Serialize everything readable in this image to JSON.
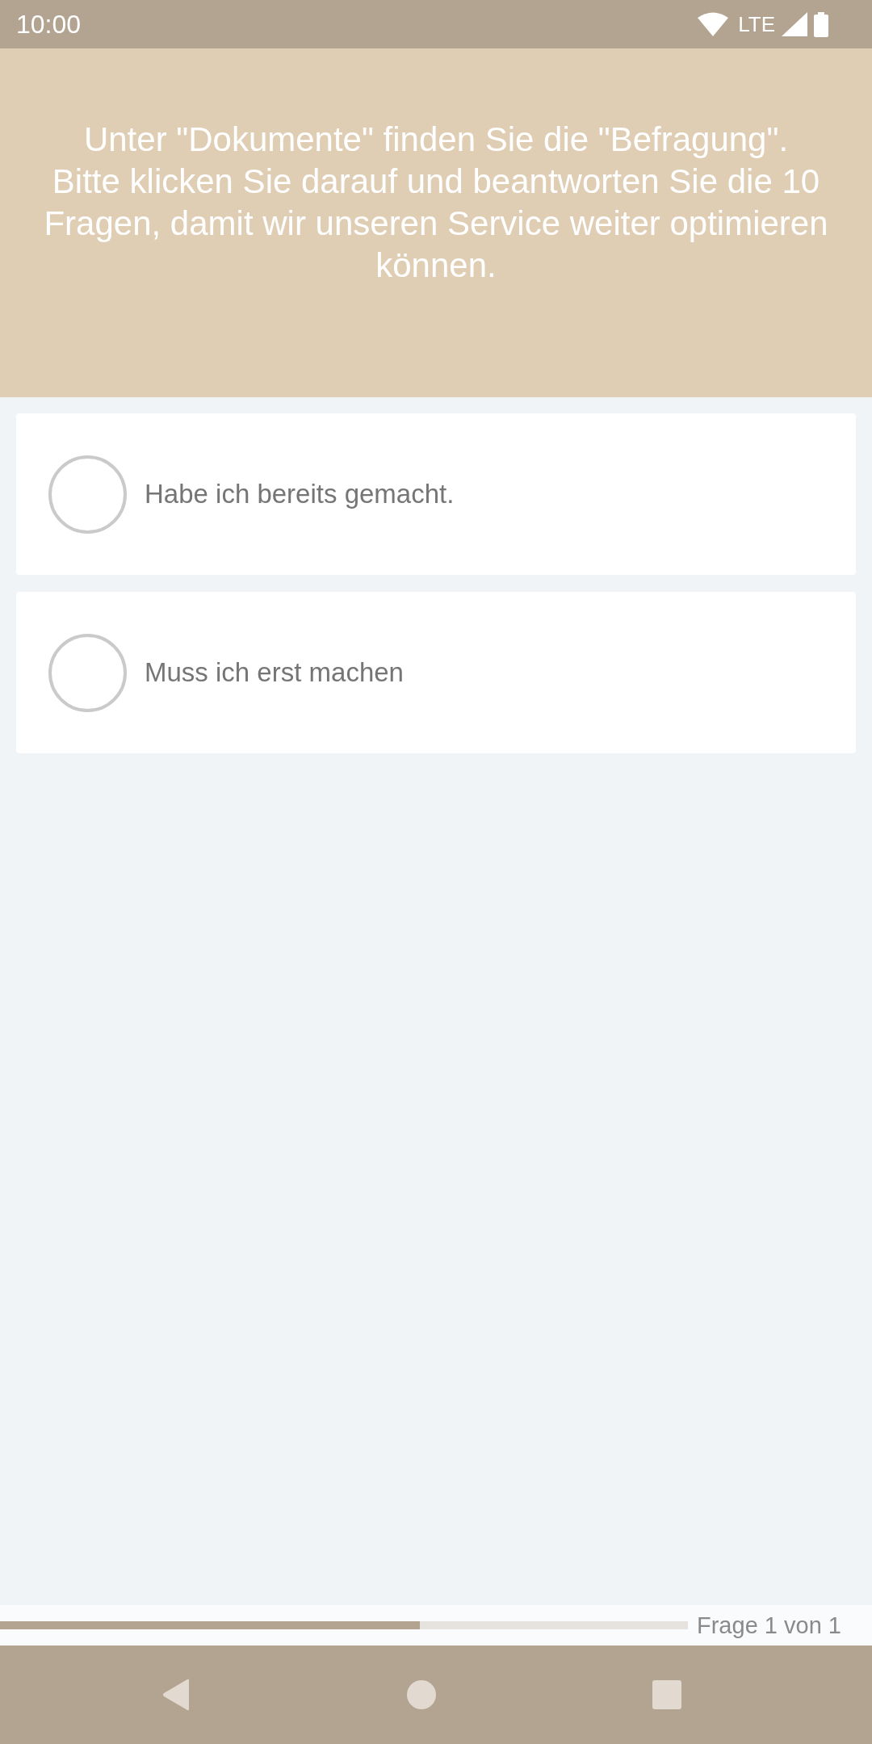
{
  "status_bar": {
    "time": "10:00",
    "network": "LTE"
  },
  "header": {
    "text": "Unter \"Dokumente\" finden Sie die \"Befragung\".\nBitte klicken Sie darauf und beantworten Sie die 10 Fragen, damit wir unseren Service weiter optimieren können."
  },
  "options": [
    {
      "label": "Habe ich bereits gemacht.",
      "selected": false
    },
    {
      "label": "Muss ich erst machen",
      "selected": false
    }
  ],
  "progress": {
    "level": 0.61,
    "label": "Frage 1 von 1"
  }
}
